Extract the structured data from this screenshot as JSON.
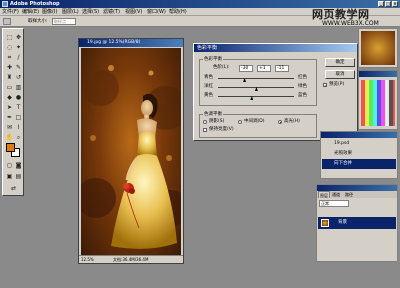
{
  "app": {
    "title": "Adobe Photoshop",
    "window_buttons": [
      "_",
      "□",
      "×"
    ]
  },
  "menubar": {
    "items": [
      "文件(F)",
      "编辑(E)",
      "图像(I)",
      "图层(L)",
      "选择(S)",
      "滤镜(T)",
      "视图(V)",
      "窗口(W)",
      "帮助(H)"
    ]
  },
  "optionsbar": {
    "sample_label": "取样大小:",
    "sample_value": "取样点"
  },
  "document": {
    "title": "19.jpg @ 12.5%(RGB/8)",
    "zoom": "12.5%",
    "doc_size": "文档:36.4M/36.4M"
  },
  "dialog": {
    "title": "色彩平衡",
    "balance_group": "色彩平衡",
    "levels_label": "色阶(L):",
    "levels": [
      "-30",
      "+1",
      "-11"
    ],
    "sliders": [
      {
        "left": "青色",
        "right": "红色",
        "value": -30
      },
      {
        "left": "洋红",
        "right": "绿色",
        "value": 1
      },
      {
        "left": "黄色",
        "right": "蓝色",
        "value": -11
      }
    ],
    "tone_group": "色调平衡",
    "tones": [
      "阴影(S)",
      "中间调(D)",
      "高光(H)"
    ],
    "selected_tone": 2,
    "preserve_luminosity": "保持亮度(V)",
    "buttons": {
      "ok": "确定",
      "cancel": "取消"
    },
    "preview_label": "预览(P)"
  },
  "watermark": {
    "line1": "网页教学网",
    "line2": "WWW.WEB3X.COM"
  },
  "history_panel": {
    "file": "19.psd",
    "items": [
      "色彩平衡",
      "曲线",
      "色彩平衡"
    ]
  },
  "actions_panel": {
    "items": [
      "光照效果",
      "向下合并"
    ]
  },
  "layers_panel": {
    "tabs": [
      "图层",
      "通道",
      "路径"
    ],
    "mode": "正常",
    "layer_name": "背景"
  }
}
